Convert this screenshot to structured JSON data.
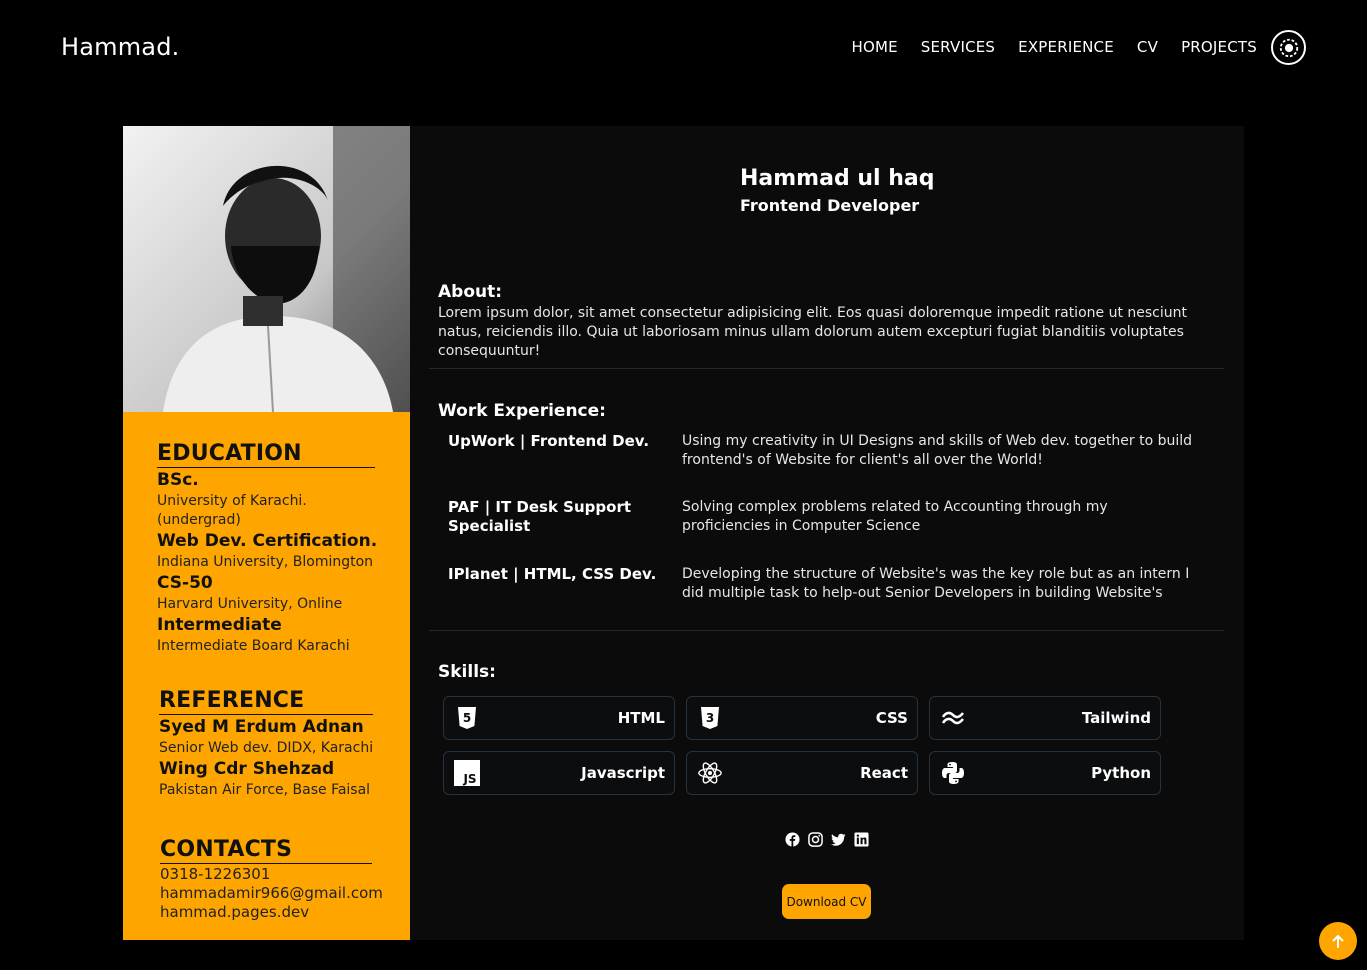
{
  "header": {
    "logo": "Hammad.",
    "nav": [
      "HOME",
      "SERVICES",
      "EXPERIENCE",
      "CV",
      "PROJECTS"
    ],
    "theme_toggle_icon": "gear-sun-icon"
  },
  "sidebar": {
    "photo_alt": "portrait-photo",
    "education_title": "EDUCATION",
    "education": [
      {
        "title": "BSc.",
        "detail": "University of Karachi. (undergrad)"
      },
      {
        "title": "Web Dev. Certification.",
        "detail": "Indiana University, Blomington"
      },
      {
        "title": "CS-50",
        "detail": "Harvard University, Online"
      },
      {
        "title": "Intermediate",
        "detail": "Intermediate Board Karachi"
      }
    ],
    "reference_title": "REFERENCE",
    "references": [
      {
        "name": "Syed M Erdum Adnan",
        "detail": "Senior Web dev. DIDX, Karachi"
      },
      {
        "name": "Wing Cdr Shehzad",
        "detail": "Pakistan Air Force, Base Faisal"
      }
    ],
    "contacts_title": "CONTACTS",
    "contacts": [
      "0318-1226301",
      "hammadamir966@gmail.com",
      "hammad.pages.dev"
    ]
  },
  "profile": {
    "name": "Hammad ul haq",
    "role": "Frontend Developer"
  },
  "about": {
    "title": "About:",
    "text": "Lorem ipsum dolor, sit amet consectetur adipisicing elit. Eos quasi doloremque impedit ratione ut nesciunt natus, reiciendis illo. Quia ut laboriosam minus ullam dolorum autem excepturi fugiat blanditiis voluptates consequuntur!"
  },
  "work": {
    "title": "Work Experience:",
    "jobs": [
      {
        "title": "UpWork | Frontend Dev.",
        "desc": "Using my creativity in UI Designs and skills of Web dev. together to build frontend's of Website for client's all over the World!"
      },
      {
        "title": "PAF | IT Desk Support Specialist",
        "desc": "Solving complex problems related to Accounting through my proficiencies in Computer Science"
      },
      {
        "title": "IPlanet | HTML, CSS Dev.",
        "desc": "Developing the structure of Website's was the key role but as an intern I did multiple task to help-out Senior Developers in building Website's"
      }
    ]
  },
  "skills": {
    "title": "Skills:",
    "items": [
      {
        "label": "HTML",
        "icon": "html5-icon"
      },
      {
        "label": "CSS",
        "icon": "css3-icon"
      },
      {
        "label": "Tailwind",
        "icon": "tailwind-icon"
      },
      {
        "label": "Javascript",
        "icon": "javascript-icon"
      },
      {
        "label": "React",
        "icon": "react-icon"
      },
      {
        "label": "Python",
        "icon": "python-icon"
      }
    ]
  },
  "socials": [
    "facebook-icon",
    "instagram-icon",
    "twitter-icon",
    "linkedin-icon"
  ],
  "download_label": "Download CV",
  "colors": {
    "accent": "#ffa500",
    "card": "#0b0b0c",
    "background": "#000000"
  }
}
